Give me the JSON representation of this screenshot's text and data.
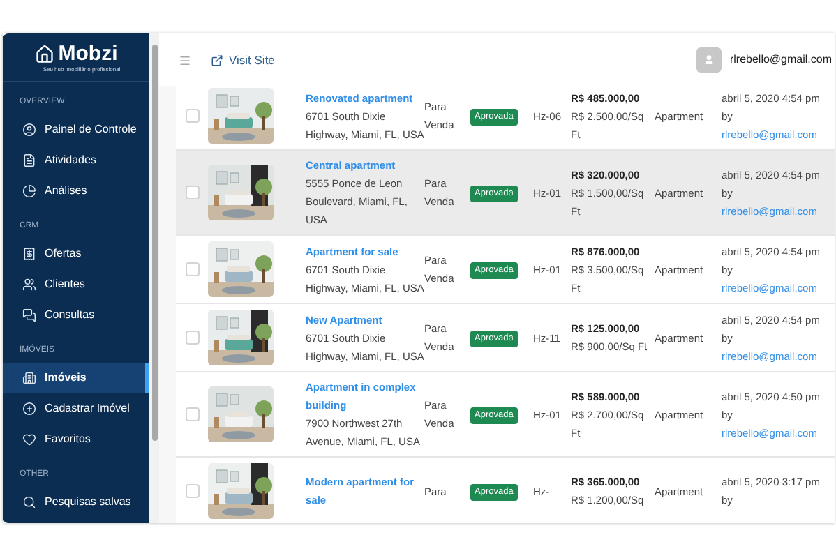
{
  "sidebar": {
    "logo": "Mobzi",
    "tagline": "Seu hub imobiliário profissional",
    "sections": [
      {
        "heading": "OVERVIEW",
        "items": [
          {
            "label": "Painel de Controle",
            "selected": false
          },
          {
            "label": "Atividades",
            "selected": false
          },
          {
            "label": "Análises",
            "selected": false
          }
        ]
      },
      {
        "heading": "CRM",
        "items": [
          {
            "label": "Ofertas",
            "selected": false
          },
          {
            "label": "Clientes",
            "selected": false
          },
          {
            "label": "Consultas",
            "selected": false
          }
        ]
      },
      {
        "heading": "IMÓVEIS",
        "items": [
          {
            "label": "Imóveis",
            "selected": true
          },
          {
            "label": "Cadastrar Imóvel",
            "selected": false
          },
          {
            "label": "Favoritos",
            "selected": false
          }
        ]
      },
      {
        "heading": "OTHER",
        "items": [
          {
            "label": "Pesquisas salvas",
            "selected": false
          }
        ]
      }
    ]
  },
  "header": {
    "visit_site": "Visit Site",
    "user_email": "rlrebello@gmail.com"
  },
  "rows": [
    {
      "selected": false,
      "checked": false,
      "title": "Renovated apartment",
      "address": "6701 South Dixie Highway, Miami, FL, USA",
      "purpose": "Para Venda",
      "status": "Aprovada",
      "code": "Hz-06",
      "price": "R$ 485.000,00",
      "price_per_area": "R$ 2.500,00/Sq Ft",
      "type": "Apartment",
      "date": "abril 5, 2020 4:54 pm",
      "by": "by",
      "author": "rlrebello@gmail.com"
    },
    {
      "selected": true,
      "checked": false,
      "title": "Central apartment",
      "address": "5555 Ponce de Leon Boulevard, Miami, FL, USA",
      "purpose": "Para Venda",
      "status": "Aprovada",
      "code": "Hz-01",
      "price": "R$ 320.000,00",
      "price_per_area": "R$ 1.500,00/Sq Ft",
      "type": "Apartment",
      "date": "abril 5, 2020 4:54 pm",
      "by": "by",
      "author": "rlrebello@gmail.com"
    },
    {
      "selected": false,
      "checked": false,
      "title": "Apartment for sale",
      "address": "6701 South Dixie Highway, Miami, FL, USA",
      "purpose": "Para Venda",
      "status": "Aprovada",
      "code": "Hz-01",
      "price": "R$ 876.000,00",
      "price_per_area": "R$ 3.500,00/Sq Ft",
      "type": "Apartment",
      "date": "abril 5, 2020 4:54 pm",
      "by": "by",
      "author": "rlrebello@gmail.com"
    },
    {
      "selected": false,
      "checked": false,
      "title": "New Apartment",
      "address": "6701 South Dixie Highway, Miami, FL, USA",
      "purpose": "Para Venda",
      "status": "Aprovada",
      "code": "Hz-11",
      "price": "R$ 125.000,00",
      "price_per_area": "R$ 900,00/Sq Ft",
      "type": "Apartment",
      "date": "abril 5, 2020 4:54 pm",
      "by": "by",
      "author": "rlrebello@gmail.com"
    },
    {
      "selected": false,
      "checked": false,
      "title": "Apartment in complex building",
      "address": "7900 Northwest 27th Avenue, Miami, FL, USA",
      "purpose": "Para Venda",
      "status": "Aprovada",
      "code": "Hz-01",
      "price": "R$ 589.000,00",
      "price_per_area": "R$ 2.700,00/Sq Ft",
      "type": "Apartment",
      "date": "abril 5, 2020 4:50 pm",
      "by": "by",
      "author": "rlrebello@gmail.com"
    },
    {
      "selected": false,
      "checked": false,
      "title": "Modern apartment for sale",
      "purpose": "Para",
      "status": "Aprovada",
      "code": "Hz-",
      "price": "R$ 365.000,00",
      "price_per_area": "R$ 1.200,00/Sq",
      "type": "Apartment",
      "date": "abril 5, 2020 3:17 pm",
      "by": "by"
    }
  ]
}
